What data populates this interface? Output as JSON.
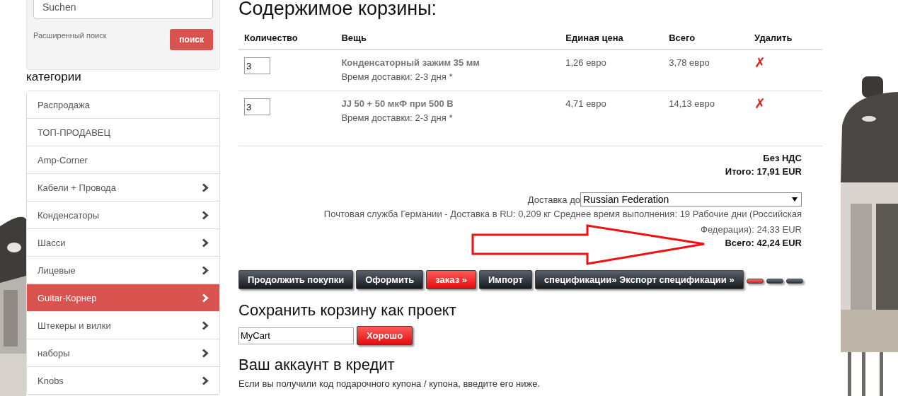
{
  "search": {
    "placeholder": "Suchen",
    "advanced_link": "Расширенный поиск",
    "button": "поиск"
  },
  "categories": {
    "title": "категории",
    "items": [
      {
        "label": "Распродажа",
        "has_children": false,
        "selected": false
      },
      {
        "label": "ТОП-ПРОДАВЕЦ",
        "has_children": false,
        "selected": false
      },
      {
        "label": "Amp-Corner",
        "has_children": false,
        "selected": false
      },
      {
        "label": "Кабели + Провода",
        "has_children": true,
        "selected": false
      },
      {
        "label": "Конденсаторы",
        "has_children": true,
        "selected": false
      },
      {
        "label": "Шасси",
        "has_children": true,
        "selected": false
      },
      {
        "label": "Лицевые",
        "has_children": true,
        "selected": false
      },
      {
        "label": "Guitar-Корнер",
        "has_children": true,
        "selected": true
      },
      {
        "label": "Штекеры и вилки",
        "has_children": true,
        "selected": false
      },
      {
        "label": "наборы",
        "has_children": true,
        "selected": false
      },
      {
        "label": "Knobs",
        "has_children": true,
        "selected": false
      }
    ]
  },
  "cart": {
    "title": "Содержимое корзины:",
    "columns": [
      "Количество",
      "Вещь",
      "Единая цена",
      "Всего",
      "Удалить"
    ],
    "rows": [
      {
        "quantity": "3",
        "name": "Конденсаторный зажим 35 мм",
        "delivery": "Время доставки: 2-3 дня *",
        "unit_price": "1,26 евро",
        "total": "3,78 евро",
        "delete": "✗"
      },
      {
        "quantity": "3",
        "name": "JJ 50 + 50 мкФ при 500 В",
        "delivery": "Время доставки: 2-3 дня *",
        "unit_price": "4,71 евро",
        "total": "14,13 евро",
        "delete": "✗"
      }
    ],
    "vat_note": "Без НДС",
    "subtotal": "Итого: 17,91 EUR",
    "shipping_label": "Доставка до",
    "shipping_country": "Russian Federation",
    "shipping_info": "Почтовая служба Германии - Доставка в RU: 0,209 кг Среднее время выполнения: 19 Рабочие дни (Российская Федерация): 24,33 EUR",
    "grand_total": "Всего: 42,24 EUR",
    "buttons": [
      {
        "kind": "text",
        "label": "Продолжить покупки",
        "highlighted": false
      },
      {
        "kind": "text",
        "label": "Оформить",
        "highlighted": false
      },
      {
        "kind": "text",
        "label": "заказ »",
        "highlighted": true
      },
      {
        "kind": "text",
        "label": "Импорт",
        "highlighted": false
      },
      {
        "kind": "text",
        "label": "спецификации» Экспорт спецификации »",
        "highlighted": false
      },
      {
        "kind": "blank",
        "highlighted": true
      },
      {
        "kind": "blank",
        "highlighted": false
      },
      {
        "kind": "blank",
        "highlighted": false
      }
    ]
  },
  "save_project": {
    "title": "Сохранить корзину как проект",
    "value": "MyCart",
    "button": "Хорошо"
  },
  "credit": {
    "title": "Ваш аккаунт в кредит",
    "text": "Если вы получили код подарочного купона / купона, введите его ниже."
  }
}
